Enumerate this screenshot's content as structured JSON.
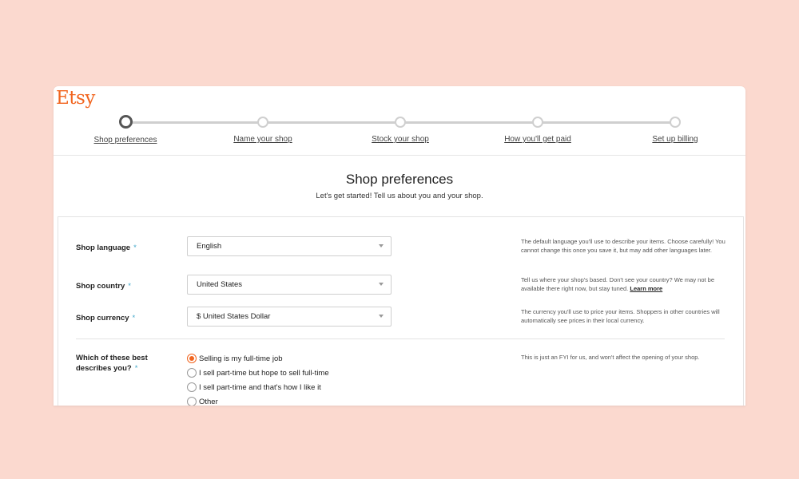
{
  "colors": {
    "background": "#fbd9cf",
    "brand": "#f1641e",
    "required": "#3fa6c9"
  },
  "brand": {
    "logo_text": "Etsy"
  },
  "stepper": {
    "steps": [
      {
        "label": "Shop preferences",
        "active": true
      },
      {
        "label": "Name your shop",
        "active": false
      },
      {
        "label": "Stock your shop",
        "active": false
      },
      {
        "label": "How you'll get paid",
        "active": false
      },
      {
        "label": "Set up billing",
        "active": false
      }
    ]
  },
  "page": {
    "title": "Shop preferences",
    "subtitle": "Let's get started! Tell us about you and your shop."
  },
  "form": {
    "required_marker": "*",
    "language": {
      "label": "Shop language",
      "value": "English",
      "help": "The default language you'll use to describe your items. Choose carefully! You cannot change this once you save it, but may add other languages later."
    },
    "country": {
      "label": "Shop country",
      "value": "United States",
      "help": "Tell us where your shop's based. Don't see your country? We may not be available there right now, but stay tuned.",
      "help_link": "Learn more"
    },
    "currency": {
      "label": "Shop currency",
      "value": "$ United States Dollar",
      "help": "The currency you'll use to price your items. Shoppers in other countries will automatically see prices in their local currency."
    },
    "describe": {
      "label_line1": "Which of these best",
      "label_line2": "describes you?",
      "help": "This is just an FYI for us, and won't affect the opening of your shop.",
      "options": [
        {
          "label": "Selling is my full-time job",
          "selected": true
        },
        {
          "label": "I sell part-time but hope to sell full-time",
          "selected": false
        },
        {
          "label": "I sell part-time and that's how I like it",
          "selected": false
        },
        {
          "label": "Other",
          "selected": false
        }
      ]
    }
  }
}
